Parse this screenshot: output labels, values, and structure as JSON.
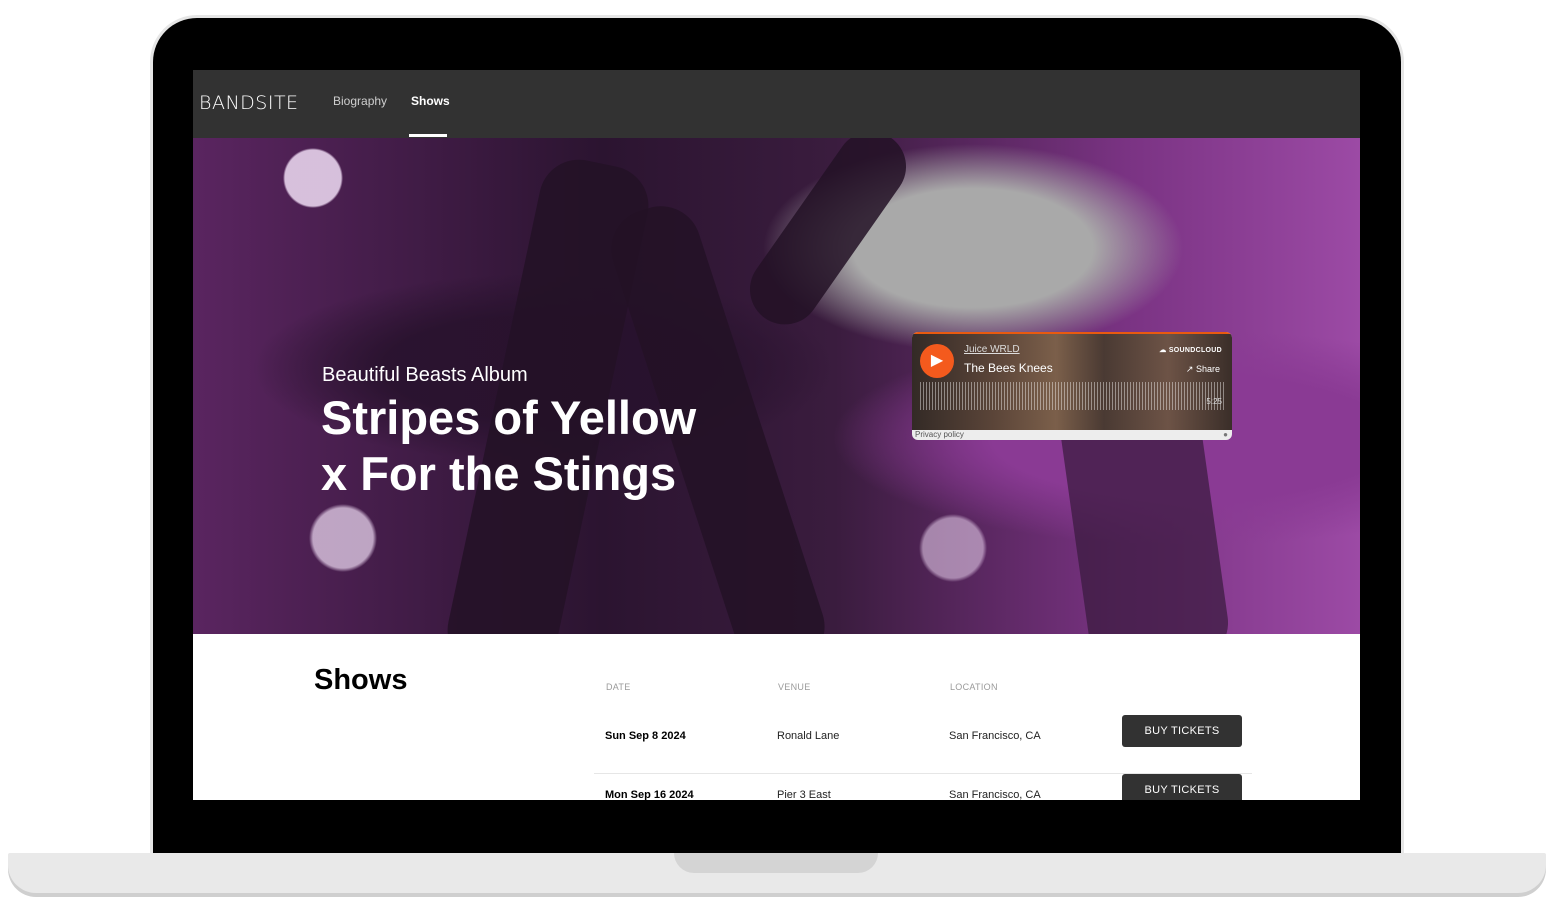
{
  "nav": {
    "logo": "BANDSITE",
    "links": [
      {
        "label": "Biography",
        "active": false
      },
      {
        "label": "Shows",
        "active": true
      }
    ]
  },
  "hero": {
    "subtitle": "Beautiful Beasts Album",
    "title_line1": "Stripes of Yellow",
    "title_line2": "x For the Stings"
  },
  "player": {
    "artist": "Juice WRLD",
    "track": "The Bees Knees",
    "brand": "SOUNDCLOUD",
    "share_label": "Share",
    "duration": "5:25",
    "privacy": "Privacy policy",
    "accent_color": "#f45a1d"
  },
  "shows": {
    "heading": "Shows",
    "columns": [
      "DATE",
      "VENUE",
      "LOCATION"
    ],
    "rows": [
      {
        "date": "Sun Sep 8 2024",
        "venue": "Ronald Lane",
        "location": "San Francisco, CA",
        "button": "BUY TICKETS"
      },
      {
        "date": "Mon Sep 16 2024",
        "venue": "Pier 3 East",
        "location": "San Francisco, CA",
        "button": "BUY TICKETS"
      }
    ]
  }
}
